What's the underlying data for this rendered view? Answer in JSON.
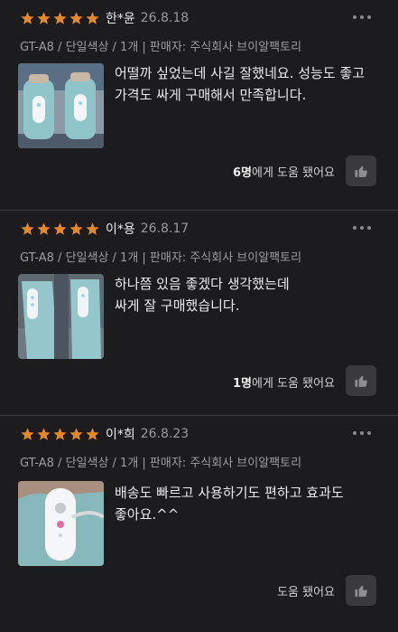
{
  "reviews": [
    {
      "rating": 5,
      "author": "한*윤",
      "date": "26.8.18",
      "option": "GT-A8 / 단일색상 / 1개  |  판매자: 주식회사 브이알팩토리",
      "text": "어떨까 싶었는데 사길 잘했네요. 성능도 좋고\n가격도 싸게 구매해서 만족합니다.",
      "helpful_count": "6명",
      "helpful_suffix": "에게 도움 됐어요",
      "photo": "leg-massager-photo"
    },
    {
      "rating": 5,
      "author": "이*용",
      "date": "26.8.17",
      "option": "GT-A8 / 단일색상 / 1개  |  판매자: 주식회사 브이알팩토리",
      "text": "하나쯤 있음 좋겠다 생각했는데\n싸게 잘 구매했습니다.",
      "helpful_count": "1명",
      "helpful_suffix": "에게 도움 됐어요",
      "photo": "leg-massager-photo"
    },
    {
      "rating": 5,
      "author": "이*희",
      "date": "26.8.23",
      "option": "GT-A8 / 단일색상 / 1개  |  판매자: 주식회사 브이알팩토리",
      "text": "배송도 빠르고 사용하기도 편하고 효과도\n좋아요.^^",
      "helpful_count": "",
      "helpful_suffix": "도움 됐어요",
      "photo": "leg-massager-photo"
    }
  ],
  "icons": {
    "star": "star-icon",
    "more": "more-horizontal-icon",
    "like": "thumbs-up-icon"
  },
  "colors": {
    "background": "#1c1c1e",
    "star": "#e8862a",
    "button": "#3a3a3c",
    "muted": "#9a9a9e"
  }
}
